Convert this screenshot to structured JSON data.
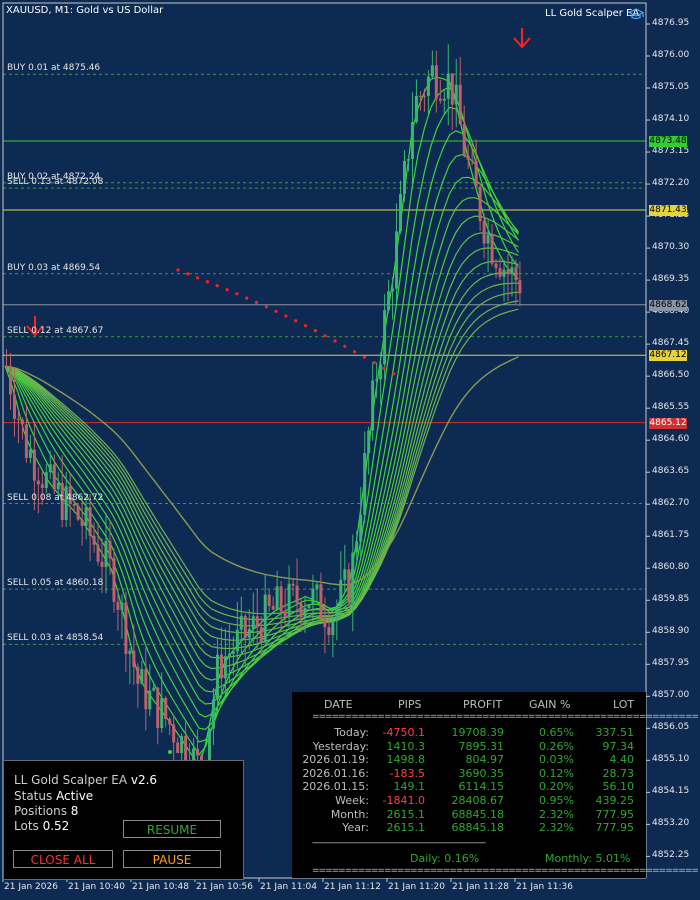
{
  "chart": {
    "symbol_line": "XAUUSD, M1:  Gold vs US Dollar",
    "ea_name": "LL Gold Scalper EA",
    "ea_icon": "graduation-cap-icon",
    "colors": {
      "background": "#0d2a52",
      "bull": "#3cb371",
      "bear": "#c0606a",
      "ribbon_fast": "#33dd33",
      "ribbon_slow": "#a0906a",
      "level_green": "#33cc33",
      "level_yellow": "#e6d23c",
      "level_red": "#d03030",
      "level_gray": "#8a94a6",
      "arrow": "#ff2020"
    }
  },
  "price_axis": {
    "min": 4852.0,
    "max": 4877.6,
    "ticks": [
      "4876.95",
      "4876.00",
      "4875.05",
      "4874.10",
      "4873.15",
      "4872.20",
      "4871.25",
      "4870.30",
      "4869.35",
      "4868.40",
      "4867.45",
      "4866.50",
      "4865.55",
      "4864.60",
      "4863.65",
      "4862.70",
      "4861.75",
      "4860.80",
      "4859.85",
      "4858.90",
      "4857.95",
      "4857.00",
      "4856.05",
      "4855.10",
      "4854.15",
      "4853.20",
      "4852.25"
    ]
  },
  "time_axis": {
    "ticks": [
      "21 Jan 2026",
      "21 Jan 10:40",
      "21 Jan 10:48",
      "21 Jan 10:56",
      "21 Jan 11:04",
      "21 Jan 11:12",
      "21 Jan 11:20",
      "21 Jan 11:28",
      "21 Jan 11:36"
    ]
  },
  "levels": [
    {
      "label": "BUY 0.01 at 4875.46",
      "price": 4875.46
    },
    {
      "label": "BUY 0.02 at 4872.24",
      "price": 4872.24
    },
    {
      "label": "SELL 0.13 at 4872.08",
      "price": 4872.08
    },
    {
      "label": "BUY 0.03 at 4869.54",
      "price": 4869.54
    },
    {
      "label": "SELL 0.12 at 4867.67",
      "price": 4867.67
    },
    {
      "label": "SELL 0.08 at 4862.72",
      "price": 4862.72
    },
    {
      "label": "SELL 0.05 at 4860.18",
      "price": 4860.18
    },
    {
      "label": "SELL 0.03 at 4858.54",
      "price": 4858.54
    }
  ],
  "price_tags": [
    {
      "text": "4873.48",
      "price": 4873.48,
      "color": "#33cc33"
    },
    {
      "text": "4871.43",
      "price": 4871.43,
      "color": "#e6d23c"
    },
    {
      "text": "4868.62",
      "price": 4868.62,
      "color": "#8a94a6"
    },
    {
      "text": "4867.12",
      "price": 4867.12,
      "color": "#e6d23c"
    },
    {
      "text": "4865.12",
      "price": 4865.12,
      "color": "#d03030"
    }
  ],
  "panel": {
    "title_prefix": "LL Gold Scalper EA ",
    "version": "v2.6",
    "status_label": "Status ",
    "status_value": "Active",
    "positions_label": "Positions ",
    "positions_value": "8",
    "lots_label": "Lots ",
    "lots_value": "0.52",
    "resume_label": "RESUME",
    "close_all_label": "CLOSE ALL",
    "pause_label": "PAUSE"
  },
  "stats": {
    "headers": [
      "DATE",
      "PIPS",
      "PROFIT",
      "GAIN %",
      "LOT"
    ],
    "separator": "===========================================================",
    "divider": "-----------------------------------------------------------------------------",
    "rows": [
      {
        "date": "Today:",
        "pips": "-4750.1",
        "profit": "19708.39",
        "gain": "0.65%",
        "lot": "337.51",
        "neg": true
      },
      {
        "date": "Yesterday:",
        "pips": "1410.3",
        "profit": "7895.31",
        "gain": "0.26%",
        "lot": "97.34",
        "neg": false
      },
      {
        "date": "2026.01.19:",
        "pips": "1498.8",
        "profit": "804.97",
        "gain": "0.03%",
        "lot": "4.40",
        "neg": false
      },
      {
        "date": "2026.01.16:",
        "pips": "-183.5",
        "profit": "3690.35",
        "gain": "0.12%",
        "lot": "28.73",
        "neg": true
      },
      {
        "date": "2026.01.15:",
        "pips": "149.1",
        "profit": "6114.15",
        "gain": "0.20%",
        "lot": "56.10",
        "neg": false
      },
      {
        "date": "Week:",
        "pips": "-1841.0",
        "profit": "28408.67",
        "gain": "0.95%",
        "lot": "439.25",
        "neg": true
      },
      {
        "date": "Month:",
        "pips": "2615.1",
        "profit": "68845.18",
        "gain": "2.32%",
        "lot": "777.95",
        "neg": false
      },
      {
        "date": "Year:",
        "pips": "2615.1",
        "profit": "68845.18",
        "gain": "2.32%",
        "lot": "777.95",
        "neg": false
      }
    ],
    "daily_label": "Daily: 0.16%",
    "monthly_label": "Monthly: 5.01%"
  }
}
